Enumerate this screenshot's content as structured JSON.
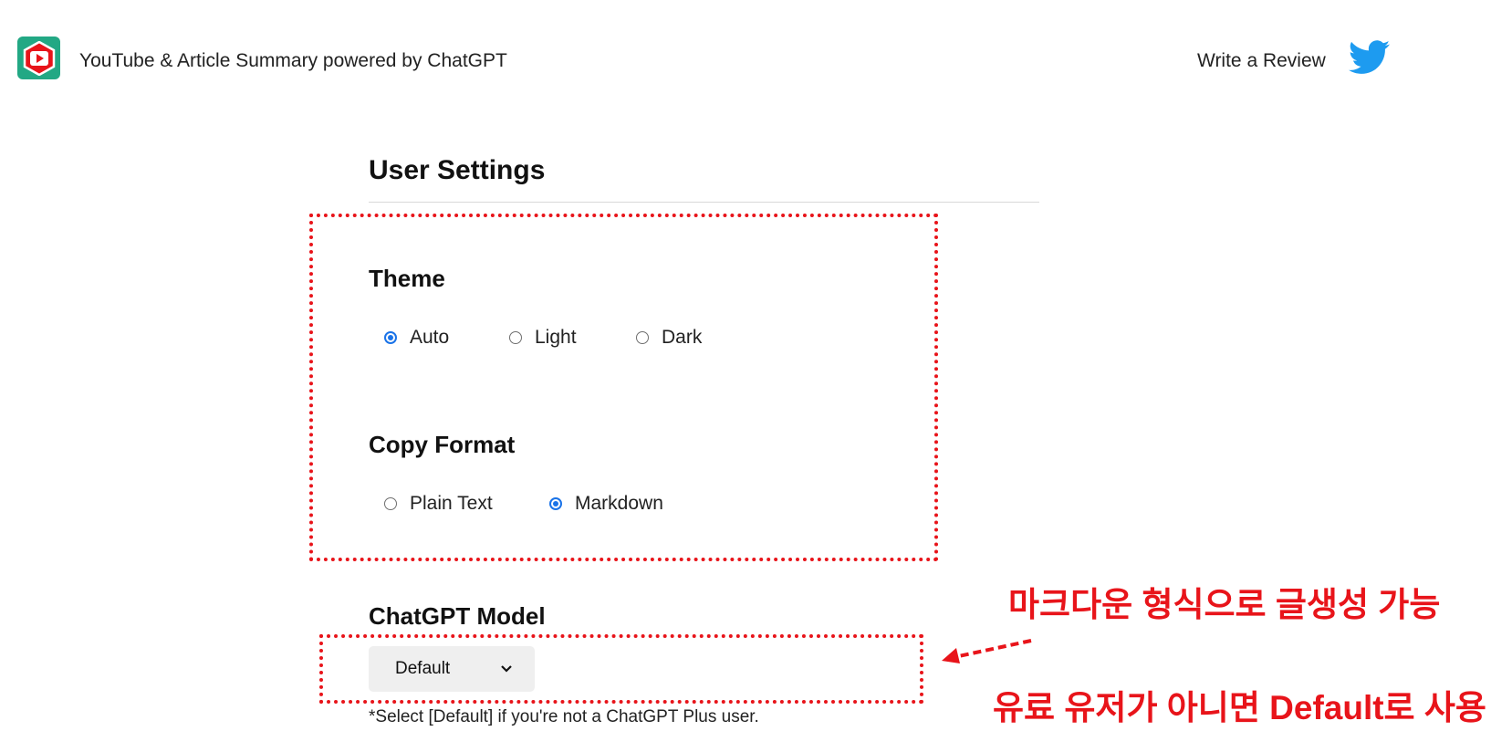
{
  "header": {
    "app_title": "YouTube & Article Summary powered by ChatGPT",
    "review_link": "Write a Review",
    "logo_icon": "youtube-summary-logo-icon",
    "social_icon": "twitter-icon"
  },
  "settings": {
    "title": "User Settings",
    "theme": {
      "label": "Theme",
      "options": [
        {
          "label": "Auto",
          "checked": true
        },
        {
          "label": "Light",
          "checked": false
        },
        {
          "label": "Dark",
          "checked": false
        }
      ]
    },
    "copy_format": {
      "label": "Copy Format",
      "options": [
        {
          "label": "Plain Text",
          "checked": false
        },
        {
          "label": "Markdown",
          "checked": true
        }
      ]
    },
    "model": {
      "label": "ChatGPT Model",
      "selected": "Default",
      "note": "*Select [Default] if you're not a ChatGPT Plus user."
    }
  },
  "annotations": {
    "markdown_note": "마크다운 형식으로 글생성 가능",
    "default_note": "유료 유저가 아니면 Default로 사용"
  },
  "colors": {
    "accent": "#1a73e8",
    "annotation_red": "#e8141a",
    "logo_green": "#22a884",
    "logo_red": "#e8141a",
    "twitter_blue": "#1d9bf0"
  }
}
